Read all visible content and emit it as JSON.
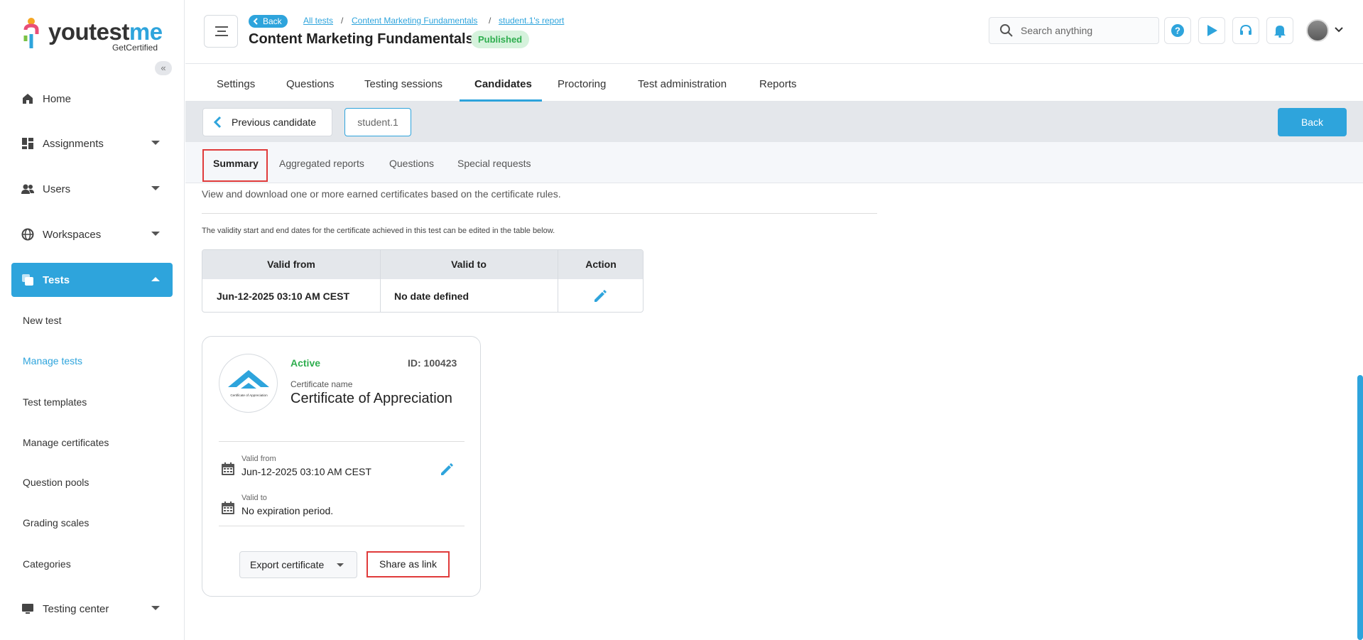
{
  "brand": {
    "logo_main": "youtest",
    "logo_accent": "me",
    "logo_sub": "GetCertified",
    "accent_color": "#2ea4dc"
  },
  "sidebar": {
    "items": [
      {
        "label": "Home",
        "icon": "home-icon"
      },
      {
        "label": "Assignments",
        "icon": "dashboard-icon"
      },
      {
        "label": "Users",
        "icon": "users-icon"
      },
      {
        "label": "Workspaces",
        "icon": "globe-icon"
      },
      {
        "label": "Tests",
        "icon": "tests-icon"
      }
    ],
    "sub_items": [
      {
        "label": "New test"
      },
      {
        "label": "Manage tests"
      },
      {
        "label": "Test templates"
      },
      {
        "label": "Manage certificates"
      },
      {
        "label": "Question pools"
      },
      {
        "label": "Grading scales"
      },
      {
        "label": "Categories"
      }
    ],
    "testing_center": "Testing center"
  },
  "header": {
    "back_label": "Back",
    "breadcrumbs": [
      "All tests",
      "Content Marketing Fundamentals",
      "student.1's report"
    ],
    "title": "Content Marketing Fundamentals",
    "status_badge": "Published",
    "search_placeholder": "Search anything"
  },
  "tabs": [
    "Settings",
    "Questions",
    "Testing sessions",
    "Candidates",
    "Proctoring",
    "Test administration",
    "Reports"
  ],
  "candidate_bar": {
    "previous_label": "Previous candidate",
    "student_label": "student.1",
    "back_label": "Back"
  },
  "subtabs": [
    "Summary",
    "Aggregated reports",
    "Questions",
    "Special requests"
  ],
  "content": {
    "description": "View and download one or more earned certificates based on the certificate rules.",
    "note": "The validity start and end dates for the certificate achieved in this test can be edited in the table below.",
    "table": {
      "headers": [
        "Valid from",
        "Valid to",
        "Action"
      ],
      "row": {
        "valid_from": "Jun-12-2025 03:10 AM CEST",
        "valid_to": "No date defined"
      }
    },
    "certificate": {
      "logo_caption": "Certificate of Appreciation",
      "status": "Active",
      "id": "ID: 100423",
      "name_label": "Certificate name",
      "name": "Certificate of Appreciation",
      "valid_from_label": "Valid from",
      "valid_from": "Jun-12-2025 03:10 AM CEST",
      "valid_to_label": "Valid to",
      "valid_to": "No expiration period.",
      "export_label": "Export certificate",
      "share_label": "Share as link"
    }
  }
}
